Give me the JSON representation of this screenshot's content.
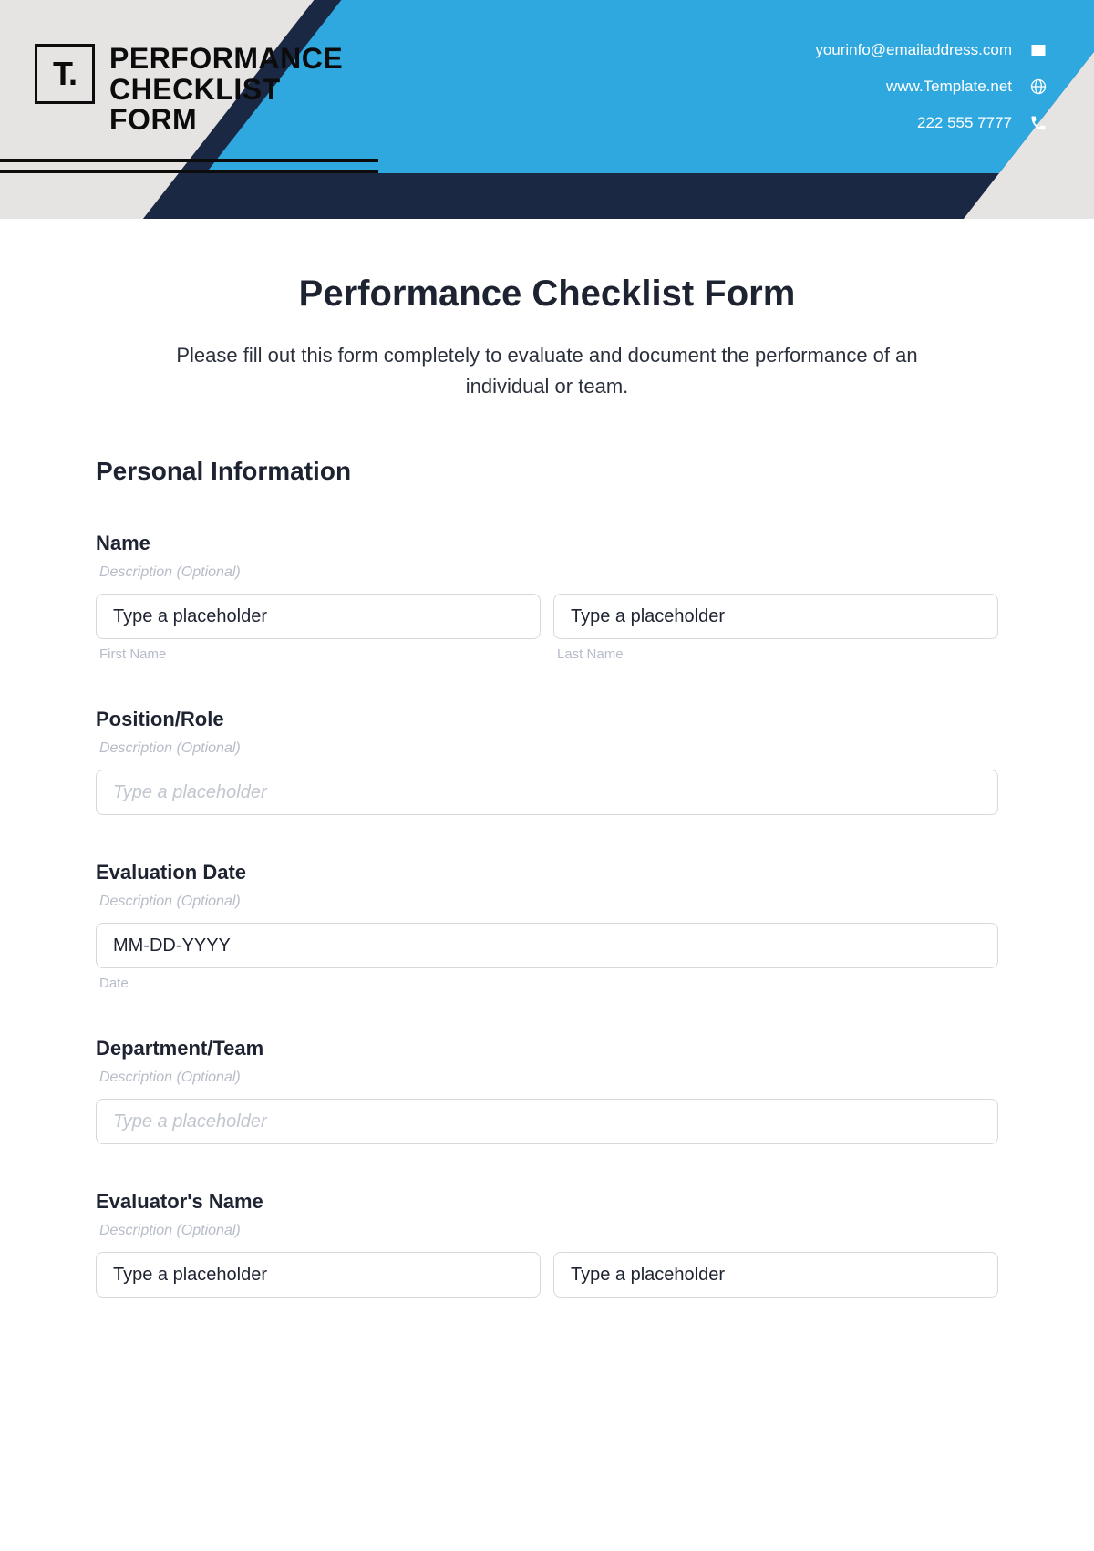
{
  "header": {
    "logo_mark": "T.",
    "title_line1": "PERFORMANCE",
    "title_line2": "CHECKLIST",
    "title_line3": "FORM",
    "contact": {
      "email": "yourinfo@emailaddress.com",
      "website": "www.Template.net",
      "phone": "222 555 7777"
    }
  },
  "form": {
    "title": "Performance Checklist Form",
    "intro": "Please fill out this form completely to evaluate and document the performance of an individual or team.",
    "section_personal": "Personal Information",
    "desc_optional": "Description (Optional)",
    "placeholder_type": "Type a placeholder",
    "fields": {
      "name": {
        "label": "Name",
        "first_sub": "First Name",
        "last_sub": "Last Name"
      },
      "position": {
        "label": "Position/Role"
      },
      "eval_date": {
        "label": "Evaluation Date",
        "placeholder": "MM-DD-YYYY",
        "sub": "Date"
      },
      "department": {
        "label": "Department/Team"
      },
      "evaluator": {
        "label": "Evaluator's Name"
      }
    }
  }
}
